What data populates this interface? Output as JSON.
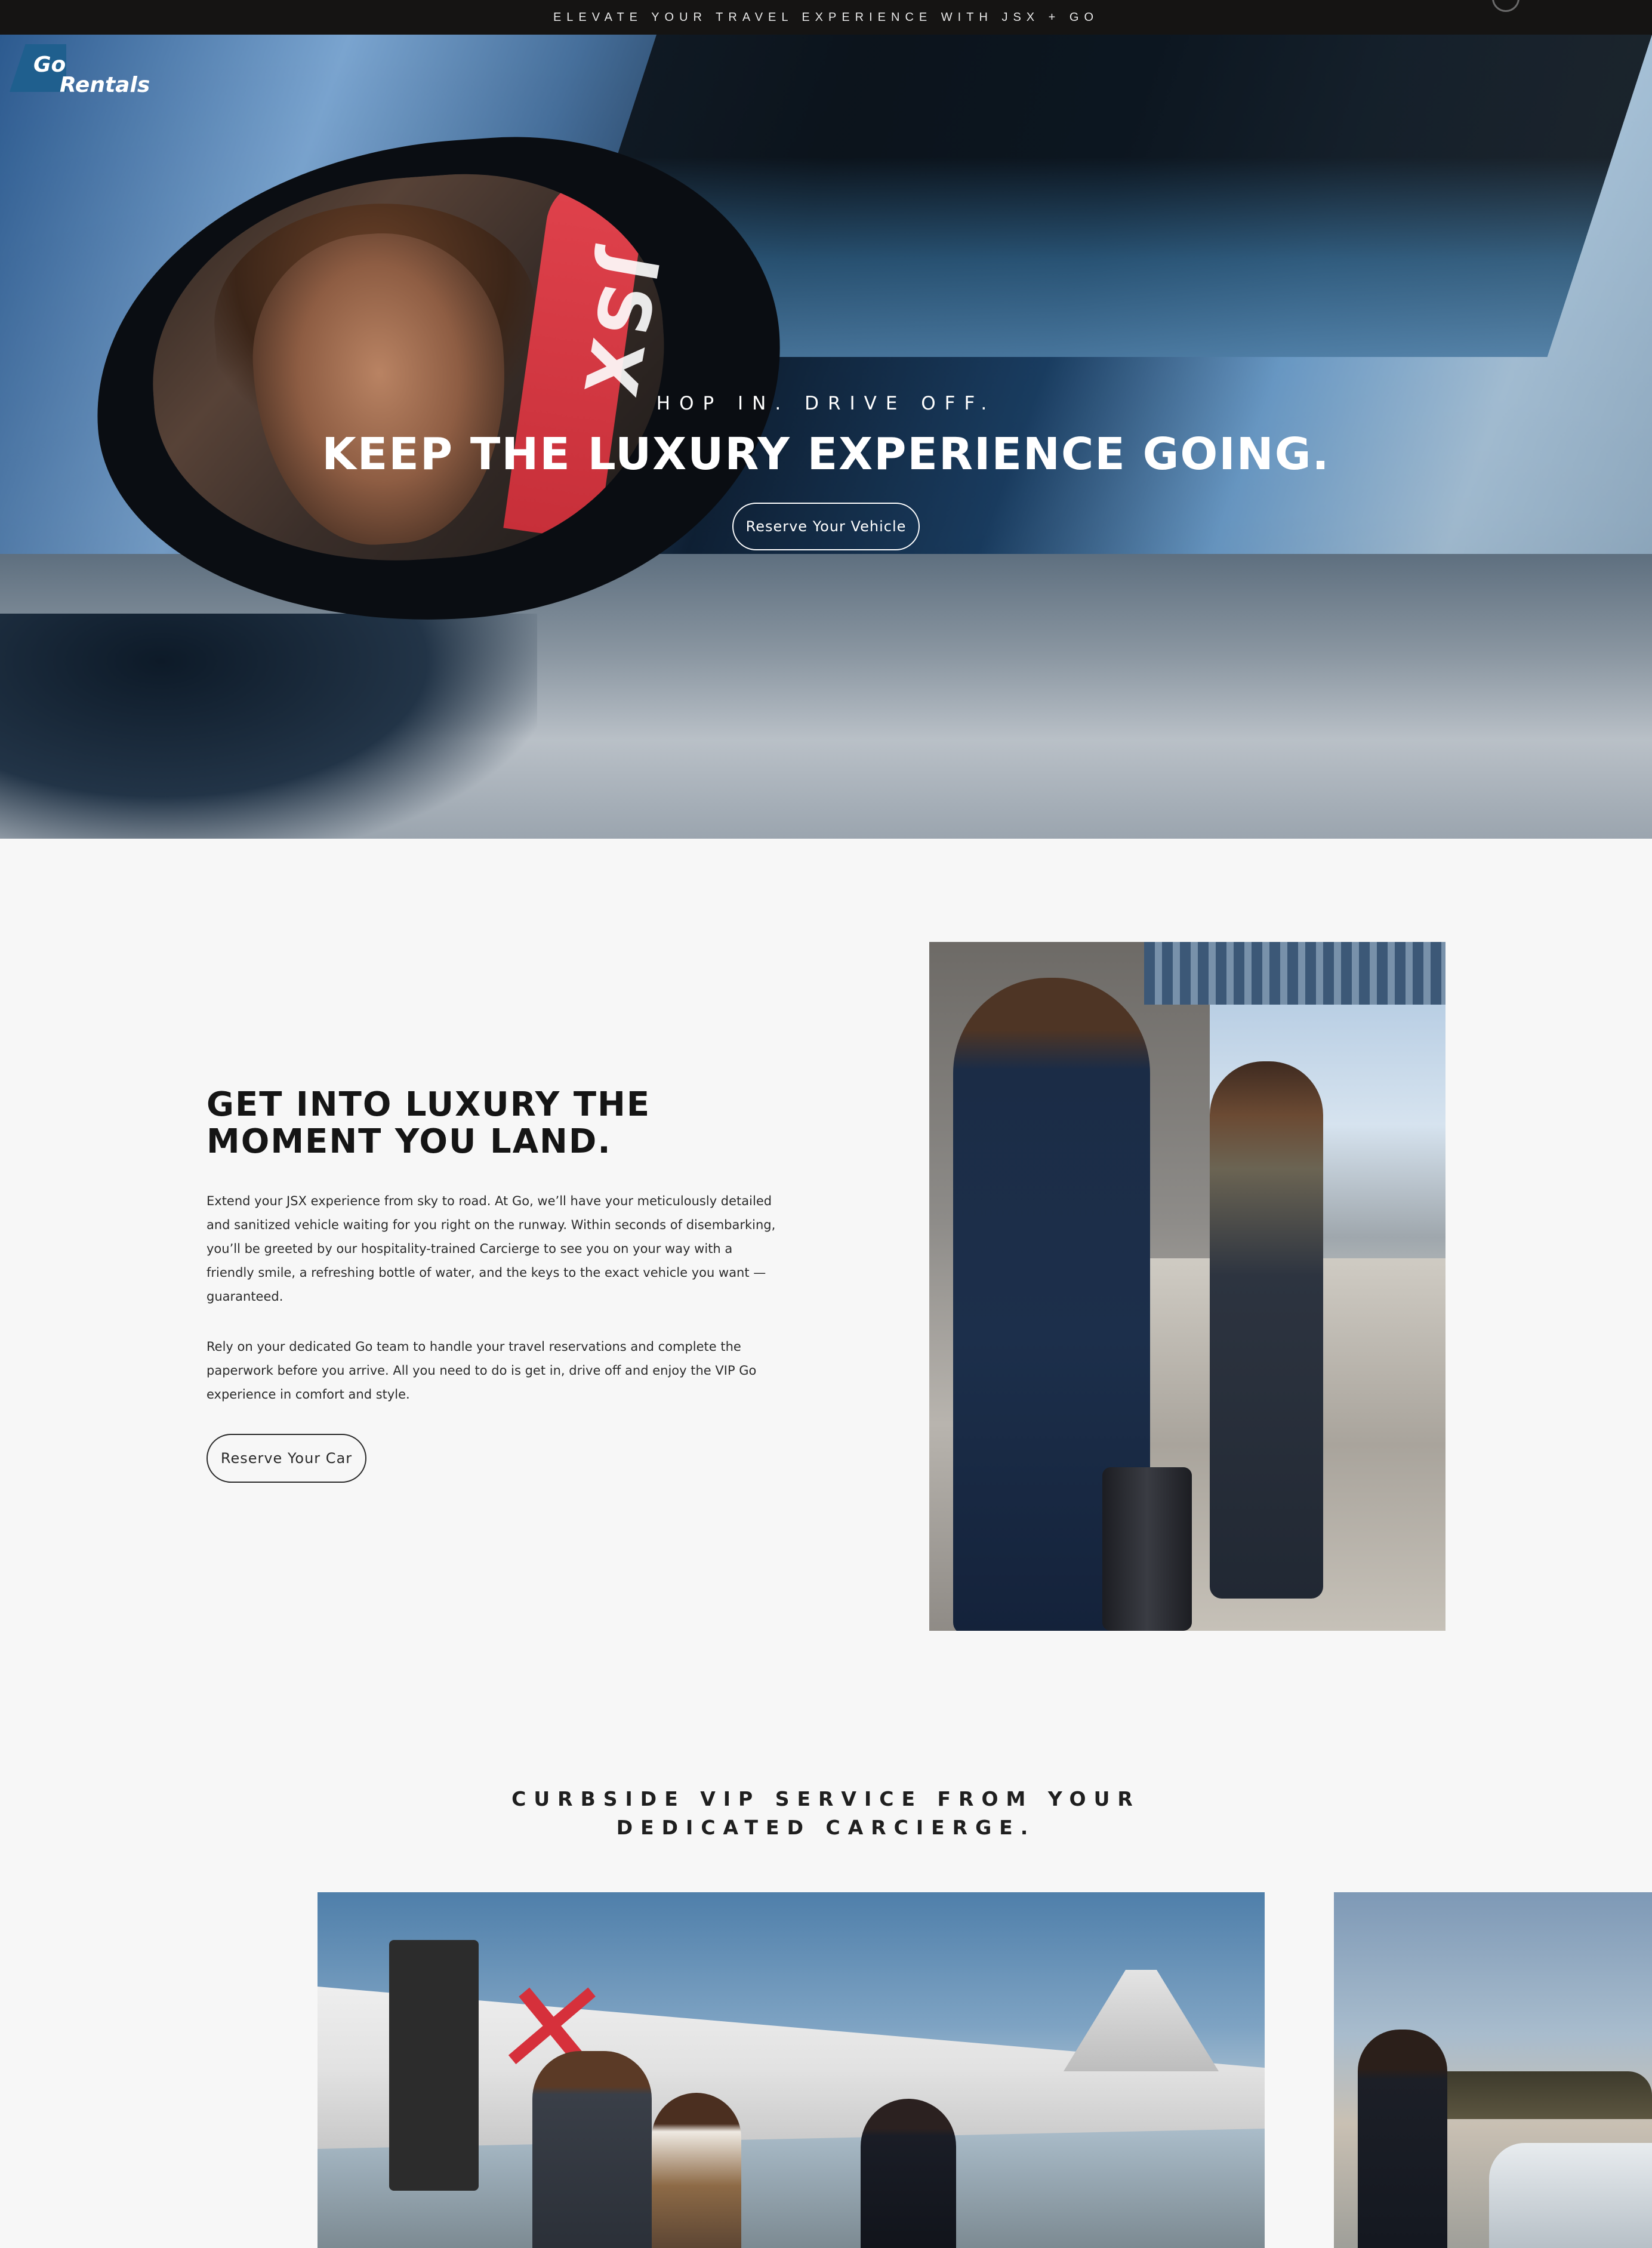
{
  "topbar": {
    "announcement": "ELEVATE YOUR TRAVEL EXPERIENCE WITH JSX + GO"
  },
  "brand": {
    "logo_line1": "Go",
    "logo_line2": "Rentals",
    "accent_color": "#1f5f8e"
  },
  "hero": {
    "eyebrow": "HOP IN. DRIVE OFF.",
    "title": "KEEP THE LUXURY EXPERIENCE GOING.",
    "button_label": "Reserve Your Vehicle",
    "image_flag_text": "JSX"
  },
  "intro": {
    "title": "GET INTO LUXURY THE MOMENT YOU LAND.",
    "paragraph1": "Extend your JSX experience from sky to road. At Go, we’ll have your meticulously detailed and sanitized vehicle waiting for you right on the runway. Within seconds of disembarking, you’ll be greeted by our hospitality-trained Carcierge to see you on your way with a friendly smile, a refreshing bottle of water, and the keys to the exact vehicle you want — guaranteed.",
    "paragraph2": "Rely on your dedicated Go team to handle your travel reservations and complete the paperwork before you arrive. All you need to do is get in, drive off and enjoy the VIP Go experience in comfort and style.",
    "button_label": "Reserve Your Car"
  },
  "vip": {
    "heading_line1": "CURBSIDE VIP SERVICE FROM YOUR",
    "heading_line2": "DEDICATED CARCIERGE."
  }
}
